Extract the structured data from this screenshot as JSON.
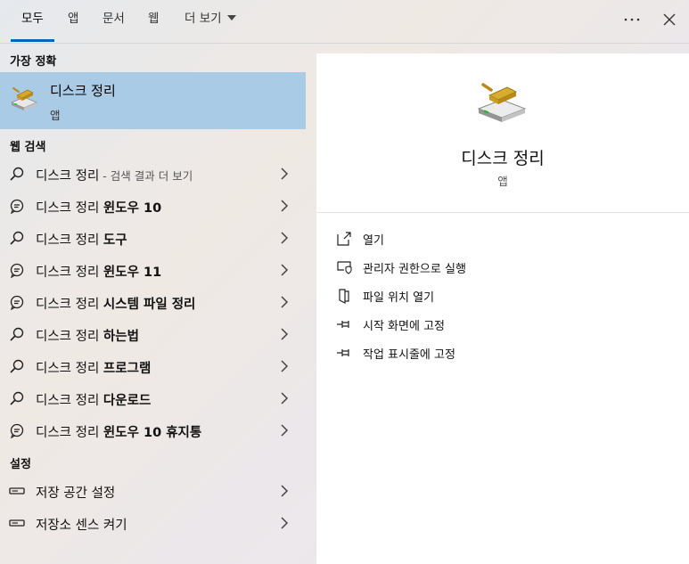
{
  "tabs": [
    {
      "label": "모두",
      "active": true
    },
    {
      "label": "앱",
      "active": false
    },
    {
      "label": "문서",
      "active": false
    },
    {
      "label": "웹",
      "active": false
    },
    {
      "label": "더 보기",
      "active": false,
      "dropdown": true
    }
  ],
  "top_icons": {
    "more": "more-icon",
    "close": "close-icon"
  },
  "best_match": {
    "section": "가장 정확",
    "title": "디스크 정리",
    "subtitle": "앱",
    "icon": "disk-cleanup-icon"
  },
  "web_search": {
    "section": "웹 검색",
    "items": [
      {
        "prefix": "디스크 정리",
        "bold": "",
        "hint": " - 검색 결과 더 보기",
        "icon": "search-icon"
      },
      {
        "prefix": "디스크 정리 ",
        "bold": "윈도우 10",
        "hint": "",
        "icon": "chat-icon"
      },
      {
        "prefix": "디스크 정리 ",
        "bold": "도구",
        "hint": "",
        "icon": "search-icon"
      },
      {
        "prefix": "디스크 정리 ",
        "bold": "윈도우 11",
        "hint": "",
        "icon": "chat-icon"
      },
      {
        "prefix": "디스크 정리 ",
        "bold": "시스템 파일 정리",
        "hint": "",
        "icon": "chat-icon"
      },
      {
        "prefix": "디스크 정리 ",
        "bold": "하는법",
        "hint": "",
        "icon": "search-icon"
      },
      {
        "prefix": "디스크 정리 ",
        "bold": "프로그램",
        "hint": "",
        "icon": "search-icon"
      },
      {
        "prefix": "디스크 정리 ",
        "bold": "다운로드",
        "hint": "",
        "icon": "search-icon"
      },
      {
        "prefix": "디스크 정리 ",
        "bold": "윈도우 10 휴지통",
        "hint": "",
        "icon": "chat-icon"
      }
    ]
  },
  "settings": {
    "section": "설정",
    "items": [
      {
        "label": "저장 공간 설정",
        "icon": "storage-icon"
      },
      {
        "label": "저장소 센스 켜기",
        "icon": "storage-icon"
      }
    ]
  },
  "detail": {
    "title": "디스크 정리",
    "subtitle": "앱",
    "actions": [
      {
        "label": "열기",
        "icon": "open-icon"
      },
      {
        "label": "관리자 권한으로 실행",
        "icon": "shield-icon"
      },
      {
        "label": "파일 위치 열기",
        "icon": "folder-icon"
      },
      {
        "label": "시작 화면에 고정",
        "icon": "pin-icon"
      },
      {
        "label": "작업 표시줄에 고정",
        "icon": "pin-icon"
      }
    ]
  }
}
